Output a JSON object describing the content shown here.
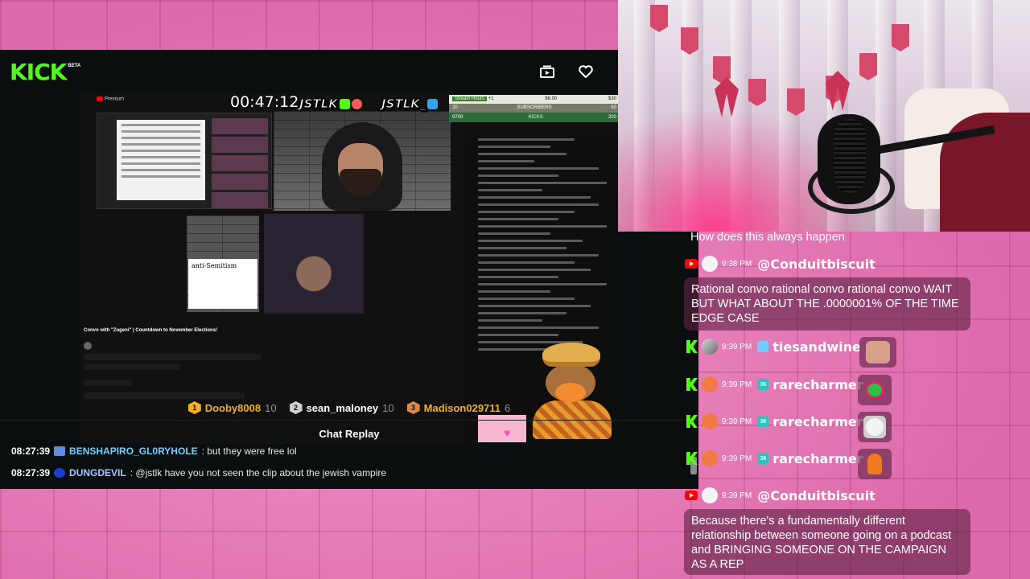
{
  "kick": {
    "logo": "KICK",
    "beta": "BETA",
    "icons": {
      "theater": "theater-mode-icon",
      "follow": "heart-icon"
    }
  },
  "stream_video": {
    "timer": "00:47:12",
    "tag_kick": "JSTLK",
    "tag_twitter": "JSTLK_",
    "yt_premium": "Premium",
    "video_title": "Convo with \"Zugeni\" | Countdown to November Elections!",
    "doc_heading": "anti-Semitism",
    "stats": {
      "stream_hours": "Stream Hours",
      "plus": "+1",
      "amount": "$6.00",
      "amount_right": "$30",
      "subs_left": "20",
      "subs_label": "SUBSCRIBERS",
      "subs_right": "50",
      "kicks_left": "9700",
      "kicks_label": "KICKS",
      "kicks_right": "200"
    }
  },
  "leaderboard": [
    {
      "rank": "1",
      "name": "Dooby8008",
      "count": "10",
      "color": "#f2b01e"
    },
    {
      "rank": "2",
      "name": "sean_maloney",
      "count": "10",
      "color": "#c8c8c8"
    },
    {
      "rank": "3",
      "name": "Madison029711",
      "count": "6",
      "color": "#d9894a"
    }
  ],
  "chat_replay": {
    "title": "Chat Replay",
    "messages": [
      {
        "time": "08:27:39",
        "user": "BENSHAPIRO_GL0RYHOLE",
        "user_color": "#6fd0ff",
        "text": ": but they were free lol"
      },
      {
        "time": "08:27:39",
        "user": "DUNGDEVIL",
        "user_color": "#a7c7ff",
        "text": ": @jstlk have you not seen the clip about the jewish vampire"
      }
    ]
  },
  "overlay_chat": {
    "top_message": "How does this always happen",
    "messages": [
      {
        "platform": "youtube",
        "time": "9:38 PM",
        "user": "@Conduitbiscuit",
        "text": "Rational convo rational convo rational convo WAIT BUT WHAT ABOUT THE .0000001% OF THE TIME EDGE CASE"
      },
      {
        "platform": "kick",
        "time": "9:39 PM",
        "user": "tiesandwine",
        "emote": "face-emote"
      },
      {
        "platform": "kick",
        "time": "9:39 PM",
        "user": "rarecharmer",
        "badge": "36",
        "emote": "frog-emote"
      },
      {
        "platform": "kick",
        "time": "9:39 PM",
        "user": "rarecharmer",
        "badge": "36",
        "emote": "cat-emote"
      },
      {
        "platform": "kick",
        "time": "9:39 PM",
        "user": "rarecharmer",
        "badge": "36",
        "emote": "charmander-emote"
      },
      {
        "platform": "youtube",
        "time": "9:39 PM",
        "user": "@Conduitbiscuit",
        "text": "Because there's a fundamentally different relationship between someone going on a podcast and BRINGING SOMEONE ON THE CAMPAIGN AS A REP"
      }
    ]
  },
  "colors": {
    "kick_green": "#53fc18",
    "background_pink": "#e377b4",
    "bubble": "#602244",
    "youtube_red": "#ff0000",
    "sub_badge": "#2ec3b8"
  }
}
